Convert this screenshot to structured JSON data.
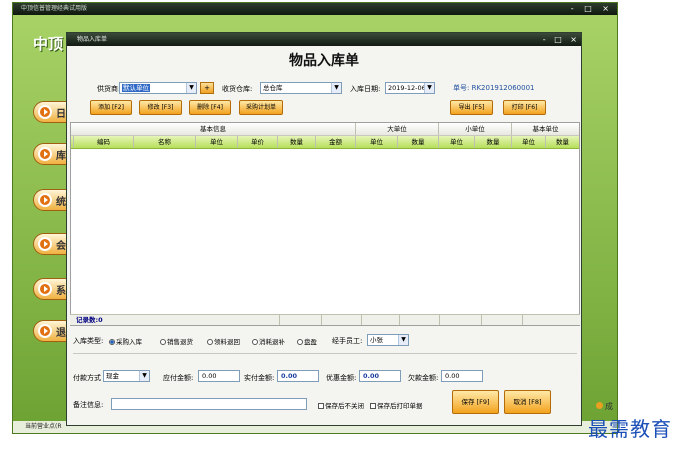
{
  "app": {
    "title": "中顶信普管理经典试用版",
    "logo": "中顶",
    "window_controls": "- □ ×",
    "sidebar": [
      {
        "label": "日"
      },
      {
        "label": "库"
      },
      {
        "label": "统"
      },
      {
        "label": "会"
      },
      {
        "label": "系"
      },
      {
        "label": "退"
      }
    ],
    "status_text": "当前营业点(R",
    "badge_text": "成"
  },
  "dialog": {
    "title": "物品入库单",
    "window_controls": [
      "-",
      "□",
      "×"
    ],
    "form_title": "物品入库单",
    "supplier": {
      "label": "供货商:",
      "value": "默认单位",
      "add_label": "+"
    },
    "warehouse": {
      "label": "收货仓库:",
      "value": "总仓库"
    },
    "date": {
      "label": "入库日期:",
      "value": "2019-12-06"
    },
    "order_no": "单号: RK201912060001",
    "toolbar": {
      "add": "添加 [F2]",
      "edit": "修改 [F3]",
      "delete": "删除 [F4]",
      "plan": "采购计划单",
      "export": "导出 [F5]",
      "print": "打印 [F6]"
    },
    "grid": {
      "group_headers": [
        "基本信息",
        "大单位",
        "小单位",
        "基本单位"
      ],
      "columns": [
        "编码",
        "名称",
        "单位",
        "单价",
        "数量",
        "金额",
        "单位",
        "数量",
        "单位",
        "数量",
        "单位",
        "数量"
      ],
      "rows": [],
      "record_count_label": "记录数:0"
    },
    "type_label": "入库类型:",
    "types": [
      {
        "label": "采购入库",
        "selected": true
      },
      {
        "label": "销售退货",
        "selected": false
      },
      {
        "label": "领料退回",
        "selected": false
      },
      {
        "label": "消耗退补",
        "selected": false
      },
      {
        "label": "盘盈",
        "selected": false
      }
    ],
    "handler_label": "经手员工:",
    "handler_value": "小张",
    "payment_label": "付款方式",
    "payment_value": "现金",
    "payable_label": "应付金额:",
    "payable_value": "0.00",
    "paid_label": "实付金额:",
    "paid_value": "0.00",
    "discount_label": "优惠金额:",
    "discount_value": "0.00",
    "owed_label": "欠款金额:",
    "owed_value": "0.00",
    "remark_label": "备注信息:",
    "remark_value": "",
    "save_no_close_label": "保存后不关闭",
    "save_print_label": "保存后打印单据",
    "save_button": "保存 [F9]",
    "cancel_button": "取消 [F8]"
  },
  "watermark": "最需教育"
}
